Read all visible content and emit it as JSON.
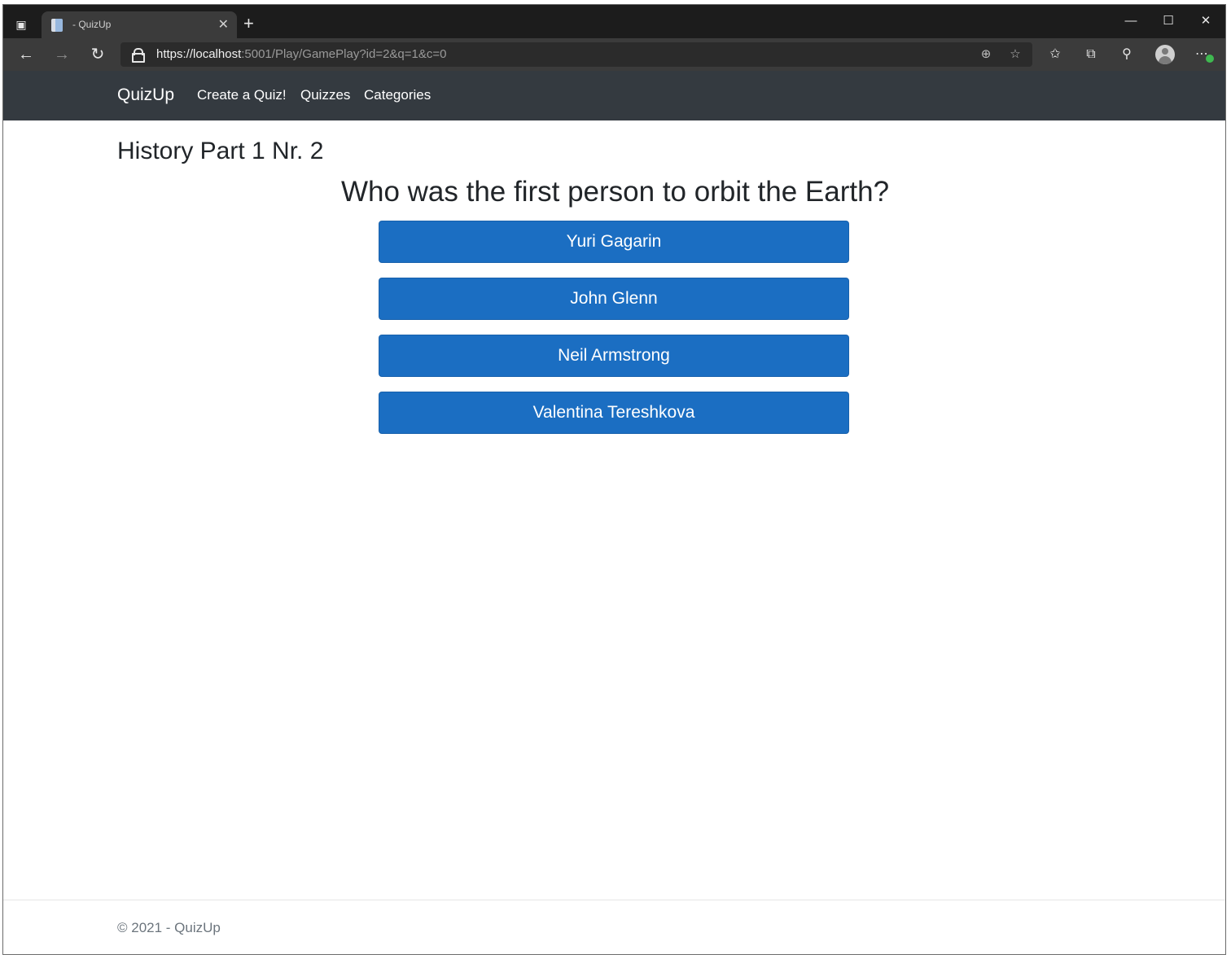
{
  "browser": {
    "tab_title": "- QuizUp",
    "tab_close": "✕",
    "new_tab": "+",
    "url_scheme": "https://",
    "url_host": "localhost",
    "url_rest": ":5001/Play/GamePlay?id=2&q=1&c=0",
    "controls": {
      "minimize": "—",
      "maximize": "☐",
      "close": "✕"
    }
  },
  "site": {
    "brand": "QuizUp",
    "nav": [
      "Create a Quiz!",
      "Quizzes",
      "Categories"
    ]
  },
  "quiz": {
    "title": "History Part 1 Nr. 2",
    "question": "Who was the first person to orbit the Earth?",
    "answers": [
      "Yuri Gagarin",
      "John Glenn",
      "Neil Armstrong",
      "Valentina Tereshkova"
    ]
  },
  "footer": {
    "text": "© 2021 - QuizUp"
  },
  "colors": {
    "navbar": "#343a40",
    "button": "#1b6ec2",
    "text": "#212529"
  },
  "icons": [
    "tab-actions-icon",
    "back-icon",
    "forward-icon",
    "refresh-icon",
    "lock-icon",
    "zoom-icon",
    "add-favorite-icon",
    "favorites-icon",
    "collections-icon",
    "extensions-icon",
    "profile-icon",
    "more-icon"
  ]
}
